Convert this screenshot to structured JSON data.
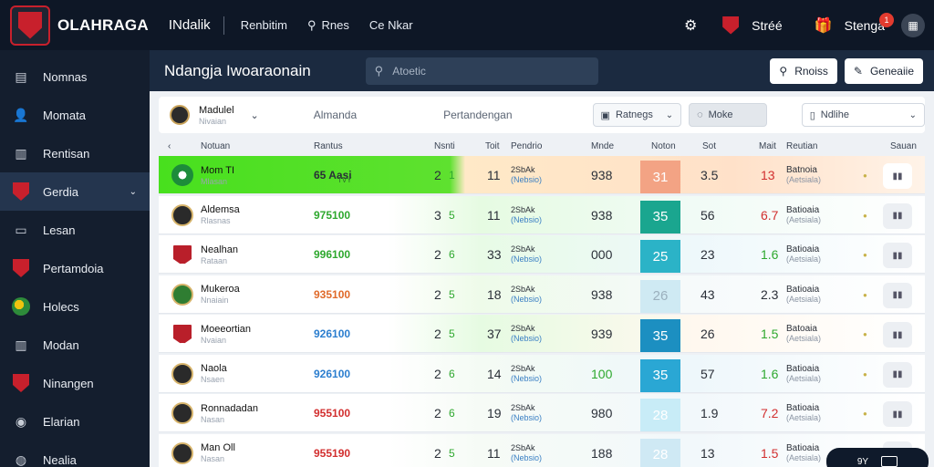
{
  "topbar": {
    "brand": "OLAHRAGA",
    "nav1": "INdalik",
    "nav2": "Renbitim",
    "nav3": "Rnes",
    "nav4": "Ce Nkar",
    "right_text1": "Stréé",
    "right_text2": "Stenga",
    "badge": "1"
  },
  "sidebar": {
    "items": [
      {
        "label": "Nomnas",
        "icon": "table-icon"
      },
      {
        "label": "Momata",
        "icon": "user-icon"
      },
      {
        "label": "Rentisan",
        "icon": "building-icon"
      },
      {
        "label": "Gerdia",
        "icon": "shield-icon",
        "active": true
      },
      {
        "label": "Lesan",
        "icon": "card-icon"
      },
      {
        "label": "Pertamdoia",
        "icon": "shield-icon"
      },
      {
        "label": "Holecs",
        "icon": "ball-icon"
      },
      {
        "label": "Modan",
        "icon": "building-icon"
      },
      {
        "label": "Ninangen",
        "icon": "shield-icon"
      },
      {
        "label": "Elarian",
        "icon": "location-icon"
      },
      {
        "label": "Nealia",
        "icon": "globe-icon"
      }
    ]
  },
  "header": {
    "title": "Ndangja Iwoaraonain",
    "search_placeholder": "Atoetic",
    "btn1": "Rnoiss",
    "btn2": "Geneaiie"
  },
  "filters": {
    "team": "Madulel",
    "team_sub": "Nivaian",
    "col1": "Almanda",
    "col2": "Pertandengan",
    "sel1": "Ratnegs",
    "sel2": "Moke",
    "sel3": "Ndlihe"
  },
  "table": {
    "headers": [
      "Notuan",
      "Rantus",
      "Nsnti",
      "Toit",
      "Pendrio",
      "Mnde",
      "Noton",
      "Sot",
      "Mait",
      "Reutian",
      "Sauan"
    ],
    "rows": [
      {
        "name": "Mom TI",
        "sub": "Mlasan",
        "pts": "65 Aasi",
        "pts_sub": "TVY",
        "w": "2",
        "d": "1",
        "g": "11",
        "m1": "2SbAk",
        "m2": "(Nebsio)",
        "p": "938",
        "box": "31",
        "s": "3.5",
        "t": "13",
        "r1": "Batnoia",
        "r2": "(Aetsiala)",
        "logo": "ball"
      },
      {
        "name": "Aldemsa",
        "sub": "Rlasnas",
        "pts": "975100",
        "w": "3",
        "d": "5",
        "g": "11",
        "m1": "2SbAk",
        "m2": "(Nebsio)",
        "p": "938",
        "box": "35",
        "s": "56",
        "t": "6.7",
        "r1": "Batioaia",
        "r2": "(Aetsiala)",
        "logo": "plain"
      },
      {
        "name": "Nealhan",
        "sub": "Rataan",
        "pts": "996100",
        "w": "2",
        "d": "6",
        "g": "33",
        "m1": "2SbAk",
        "m2": "(Nebsio)",
        "p": "000",
        "box": "25",
        "s": "23",
        "t": "1.6",
        "r1": "Batioaia",
        "r2": "(Aetsiala)",
        "logo": "shield"
      },
      {
        "name": "Mukeroa",
        "sub": "Nnaiain",
        "pts": "935100",
        "w": "2",
        "d": "5",
        "g": "18",
        "m1": "2SbAk",
        "m2": "(Nebsio)",
        "p": "938",
        "box": "26",
        "s": "43",
        "t": "2.3",
        "r1": "Batioaia",
        "r2": "(Aetsiala)",
        "logo": "green"
      },
      {
        "name": "Moeeortian",
        "sub": "Nvaian",
        "pts": "926100",
        "w": "2",
        "d": "5",
        "g": "37",
        "m1": "2SbAk",
        "m2": "(Nebsio)",
        "p": "939",
        "box": "35",
        "s": "26",
        "t": "1.5",
        "r1": "Batoaia",
        "r2": "(Aetsiala)",
        "logo": "shield"
      },
      {
        "name": "Naola",
        "sub": "Nsaen",
        "pts": "926100",
        "w": "2",
        "d": "6",
        "g": "14",
        "m1": "2SbAk",
        "m2": "(Nebsio)",
        "p": "100",
        "box": "35",
        "s": "57",
        "t": "1.6",
        "r1": "Batioaia",
        "r2": "(Aetsiala)",
        "logo": "plain"
      },
      {
        "name": "Ronnadadan",
        "sub": "Nasan",
        "pts": "955100",
        "w": "2",
        "d": "6",
        "g": "19",
        "m1": "2SbAk",
        "m2": "(Nebsio)",
        "p": "980",
        "box": "28",
        "s": "1.9",
        "t": "7.2",
        "r1": "Batioaia",
        "r2": "(Aetsiala)",
        "logo": "plain"
      },
      {
        "name": "Man Oll",
        "sub": "Nasan",
        "pts": "955190",
        "w": "2",
        "d": "5",
        "g": "11",
        "m1": "2SbAk",
        "m2": "(Nebsio)",
        "p": "188",
        "box": "28",
        "s": "13",
        "t": "1.5",
        "r1": "Batioaia",
        "r2": "(Aetsiala)",
        "logo": "plain"
      }
    ]
  },
  "float": {
    "label": "9Y"
  }
}
